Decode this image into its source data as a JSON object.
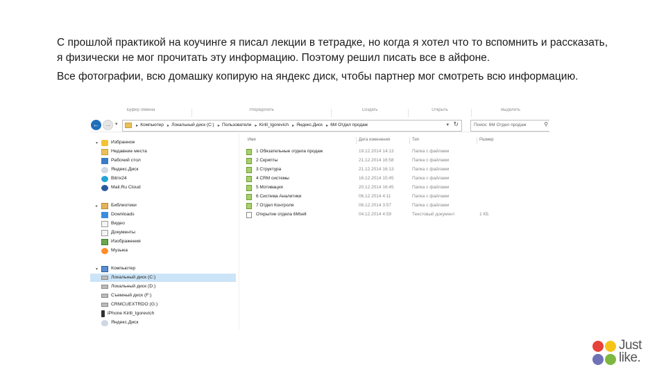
{
  "paragraphs": {
    "p1": "С прошлой практикой на коучинге я писал лекции в тетрадке, но когда я хотел что то вспомнить и рассказать, я физически не мог прочитать эту информацию. Поэтому решил писать все в айфоне.",
    "p2": "Все фотографии, всю домашку копирую на яндекс диск, чтобы партнер мог смотреть всю информацию."
  },
  "explorer": {
    "ribbon_groups": [
      "Буфер обмена",
      "Упорядочить",
      "Создать",
      "Открыть",
      "Выделить"
    ],
    "address": {
      "crumbs": [
        "Компьютер",
        "Локальный диск (C:)",
        "Пользователи",
        "Kirill_Igorevich",
        "Яндекс.Диск",
        "6М Отдел продаж"
      ]
    },
    "search_placeholder": "Поиск: 6М Отдел продаж",
    "nav": {
      "favorites_header": "Избранное",
      "favorites": [
        "Недавние места",
        "Рабочий стол",
        "Яндекс.Диск",
        "Bitrix24",
        "Mail.Ru Cloud"
      ],
      "libraries_header": "Библиотеки",
      "libraries": [
        "Downloads",
        "Видео",
        "Документы",
        "Изображения",
        "Музыка"
      ],
      "computer_header": "Компьютер",
      "computer": [
        "Локальный диск (C:)",
        "Локальный диск (D:)",
        "Съемный диск (F:)",
        "CRMCUEXTRDO (G:)",
        "iPhone Kirill_Igorevich",
        "Яндекс.Диск"
      ]
    },
    "columns": {
      "name": "Имя",
      "date": "Дата изменения",
      "type": "Тип",
      "size": "Размер"
    },
    "files": [
      {
        "name": "1 Обязательные отдела продаж",
        "date": "19.12.2014 14:13",
        "type": "Папка с файлами",
        "size": ""
      },
      {
        "name": "2 Скрипты",
        "date": "21.12.2014 16:58",
        "type": "Папка с файлами",
        "size": ""
      },
      {
        "name": "3 Структура",
        "date": "21.12.2014 16:13",
        "type": "Папка с файлами",
        "size": ""
      },
      {
        "name": "4 CRM системы",
        "date": "16.12.2014 15:45",
        "type": "Папка с файлами",
        "size": ""
      },
      {
        "name": "5 Мотивация",
        "date": "20.12.2014 16:45",
        "type": "Папка с файлами",
        "size": ""
      },
      {
        "name": "6 Система Аналитики",
        "date": "06.12.2014 4:11",
        "type": "Папка с файлами",
        "size": ""
      },
      {
        "name": "7 Отдел Контроля",
        "date": "06.12.2014 3:57",
        "type": "Папка с файлами",
        "size": ""
      },
      {
        "name": "Открытие отдела 6Мsell",
        "date": "04.12.2014 4:59",
        "type": "Текстовый документ",
        "size": "1 КБ"
      }
    ]
  },
  "logo": {
    "line1": "Just",
    "line2": "like."
  }
}
